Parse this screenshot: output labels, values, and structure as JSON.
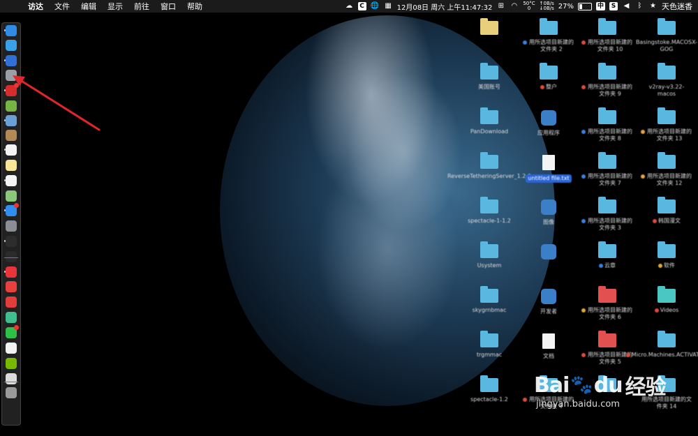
{
  "menubar": {
    "app_name": "访达",
    "menus": [
      "文件",
      "编辑",
      "显示",
      "前往",
      "窗口",
      "帮助"
    ],
    "datetime": "12月08日 周六 上午11:47:32",
    "temperature": "50°C",
    "temperature_sub": "0",
    "network_up": "0B/s",
    "network_down": "0B/s",
    "battery_percent": "27%",
    "battery_level": 0.27,
    "input_method": "中",
    "user_name": "天色迷香",
    "icons": [
      "apple-icon",
      "cloud-icon",
      "c-icon",
      "globe-icon",
      "calendar-icon",
      "grid-icon",
      "wifi-icon",
      "battery-icon",
      "s-icon",
      "volume-icon",
      "bluetooth-icon",
      "star-icon"
    ]
  },
  "dock": {
    "apps": [
      {
        "name": "finder-icon",
        "color": "#2f8be6"
      },
      {
        "name": "safari-icon",
        "color": "#3aa0e8"
      },
      {
        "name": "compass-icon",
        "color": "#2f6fd6"
      },
      {
        "name": "disk-utility-icon",
        "color": "#9aa0a6"
      },
      {
        "name": "netease-music-icon",
        "color": "#d62c2c"
      },
      {
        "name": "android-icon",
        "color": "#76b543"
      },
      {
        "name": "preview-icon",
        "color": "#6aa0d8"
      },
      {
        "name": "notebook-icon",
        "color": "#b38a55"
      },
      {
        "name": "calendar-icon",
        "color": "#f3f3f3"
      },
      {
        "name": "notes-icon",
        "color": "#f7e59a"
      },
      {
        "name": "reminders-icon",
        "color": "#f5f5f5"
      },
      {
        "name": "maps-icon",
        "color": "#8bc77a"
      },
      {
        "name": "app-store-icon",
        "color": "#2f8ef0"
      },
      {
        "name": "system-preferences-icon",
        "color": "#8a8f96"
      },
      {
        "name": "activity-monitor-icon",
        "color": "#2d2d2d"
      },
      {
        "name": "terminal-icon",
        "color": "#2b2b2b"
      },
      {
        "name": "yandex-browser-icon",
        "color": "#e8343b"
      },
      {
        "name": "vivaldi-icon",
        "color": "#e64040"
      },
      {
        "name": "weibo-icon",
        "color": "#e23d3d"
      },
      {
        "name": "green-app-icon",
        "color": "#3fbf8f"
      },
      {
        "name": "wechat-icon",
        "color": "#2fc04a"
      },
      {
        "name": "textedit-icon",
        "color": "#f3f3f3"
      },
      {
        "name": "nvidia-icon",
        "color": "#76b900"
      },
      {
        "name": "downloads-icon",
        "color": "#dcdcdc"
      },
      {
        "name": "trash-icon",
        "color": "#9a9a9a"
      }
    ]
  },
  "desktop": {
    "icons": [
      {
        "label": "",
        "kind": "folder yellow",
        "tag": ""
      },
      {
        "label": "用所选项目新建的文件夹 2",
        "kind": "folder",
        "tag": "#3b7fe0"
      },
      {
        "label": "用所选项目新建的文件夹 10",
        "kind": "folder",
        "tag": "#e04a3b"
      },
      {
        "label": "Basingstoke.MACOSX-GOG",
        "kind": "folder",
        "tag": ""
      },
      {
        "label": "美国账号",
        "kind": "folder",
        "tag": ""
      },
      {
        "label": "整户",
        "kind": "folder",
        "tag": "#e04a3b"
      },
      {
        "label": "用所选项目新建的文件夹 9",
        "kind": "folder",
        "tag": "#e04a3b"
      },
      {
        "label": "v2ray-v3.22-macos",
        "kind": "folder",
        "tag": ""
      },
      {
        "label": "PanDownload",
        "kind": "folder",
        "tag": ""
      },
      {
        "label": "应用程序",
        "kind": "app",
        "tag": ""
      },
      {
        "label": "用所选项目新建的文件夹 8",
        "kind": "folder",
        "tag": "#3b7fe0"
      },
      {
        "label": "用所选项目新建的文件夹 13",
        "kind": "folder",
        "tag": "#e0a53b"
      },
      {
        "label": "ReverseTetheringServer_1.2.0",
        "kind": "folder",
        "tag": ""
      },
      {
        "label": "untitled file.txt",
        "kind": "doc",
        "tag": "",
        "selected": true
      },
      {
        "label": "用所选项目新建的文件夹 7",
        "kind": "folder",
        "tag": "#3b7fe0"
      },
      {
        "label": "用所选项目新建的文件夹 12",
        "kind": "folder",
        "tag": "#e0a53b"
      },
      {
        "label": "spectacle-1-1.2",
        "kind": "folder",
        "tag": ""
      },
      {
        "label": "图像",
        "kind": "app",
        "tag": ""
      },
      {
        "label": "用所选项目新建的文件夹 3",
        "kind": "folder",
        "tag": "#3b7fe0"
      },
      {
        "label": "韩国漫文",
        "kind": "folder",
        "tag": "#e04a3b"
      },
      {
        "label": "Usystem",
        "kind": "folder",
        "tag": ""
      },
      {
        "label": "",
        "kind": "app",
        "tag": ""
      },
      {
        "label": "云章",
        "kind": "folder",
        "tag": "#3b7fe0"
      },
      {
        "label": "软件",
        "kind": "folder",
        "tag": "#e0a53b"
      },
      {
        "label": "skygrnbmac",
        "kind": "folder",
        "tag": ""
      },
      {
        "label": "开发者",
        "kind": "app",
        "tag": ""
      },
      {
        "label": "用所选项目新建的文件夹 6",
        "kind": "folder red",
        "tag": "#e0a53b"
      },
      {
        "label": "Videos",
        "kind": "folder teal",
        "tag": "#e04a3b"
      },
      {
        "label": "trgmmac",
        "kind": "folder",
        "tag": ""
      },
      {
        "label": "文档",
        "kind": "doc",
        "tag": ""
      },
      {
        "label": "用所选项目新建的文件夹 5",
        "kind": "folder red",
        "tag": "#e04a3b"
      },
      {
        "label": "Micro.Machines.ACTIVATED",
        "kind": "folder",
        "tag": "#e04a3b"
      },
      {
        "label": "spectacle-1.2",
        "kind": "folder",
        "tag": ""
      },
      {
        "label": "用所选项目新建的文件夹 4",
        "kind": "folder",
        "tag": "#e04a3b"
      },
      {
        "label": "",
        "kind": "folder",
        "tag": ""
      },
      {
        "label": "用所选项目新建的文件夹 14",
        "kind": "folder",
        "tag": ""
      }
    ]
  },
  "watermark": {
    "brand": "Bai",
    "brand_suffix": "du",
    "cn_text": "经验",
    "url": "jingyan.baidu.com"
  },
  "colors": {
    "arrow": "#e0262b",
    "menubar_bg": "#1b1b1b"
  }
}
